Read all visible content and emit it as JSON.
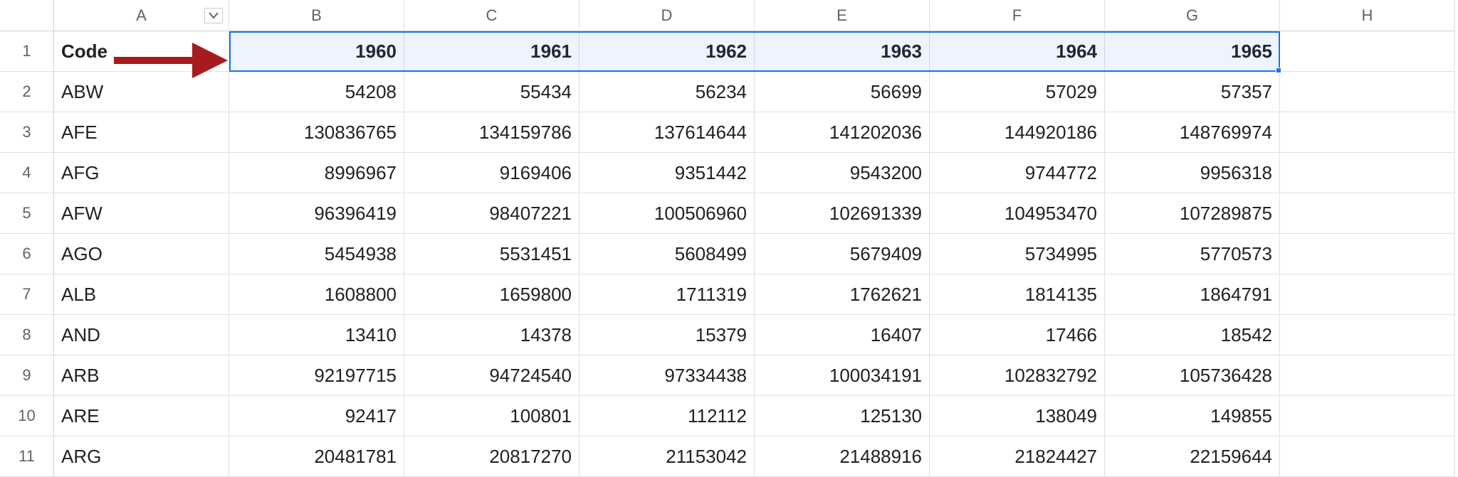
{
  "columns": [
    "",
    "A",
    "B",
    "C",
    "D",
    "E",
    "F",
    "G",
    "H"
  ],
  "row_numbers": [
    "1",
    "2",
    "3",
    "4",
    "5",
    "6",
    "7",
    "8",
    "9",
    "10",
    "11"
  ],
  "header_row": {
    "code": "Code",
    "years": [
      "1960",
      "1961",
      "1962",
      "1963",
      "1964",
      "1965"
    ]
  },
  "data_rows": [
    {
      "code": "ABW",
      "values": [
        "54208",
        "55434",
        "56234",
        "56699",
        "57029",
        "57357"
      ]
    },
    {
      "code": "AFE",
      "values": [
        "130836765",
        "134159786",
        "137614644",
        "141202036",
        "144920186",
        "148769974"
      ]
    },
    {
      "code": "AFG",
      "values": [
        "8996967",
        "9169406",
        "9351442",
        "9543200",
        "9744772",
        "9956318"
      ]
    },
    {
      "code": "AFW",
      "values": [
        "96396419",
        "98407221",
        "100506960",
        "102691339",
        "104953470",
        "107289875"
      ]
    },
    {
      "code": "AGO",
      "values": [
        "5454938",
        "5531451",
        "5608499",
        "5679409",
        "5734995",
        "5770573"
      ]
    },
    {
      "code": "ALB",
      "values": [
        "1608800",
        "1659800",
        "1711319",
        "1762621",
        "1814135",
        "1864791"
      ]
    },
    {
      "code": "AND",
      "values": [
        "13410",
        "14378",
        "15379",
        "16407",
        "17466",
        "18542"
      ]
    },
    {
      "code": "ARB",
      "values": [
        "92197715",
        "94724540",
        "97334438",
        "100034191",
        "102832792",
        "105736428"
      ]
    },
    {
      "code": "ARE",
      "values": [
        "92417",
        "100801",
        "112112",
        "125130",
        "138049",
        "149855"
      ]
    },
    {
      "code": "ARG",
      "values": [
        "20481781",
        "20817270",
        "21153042",
        "21488916",
        "21824427",
        "22159644"
      ]
    }
  ],
  "selection": {
    "start": "B1",
    "end": "G1"
  }
}
